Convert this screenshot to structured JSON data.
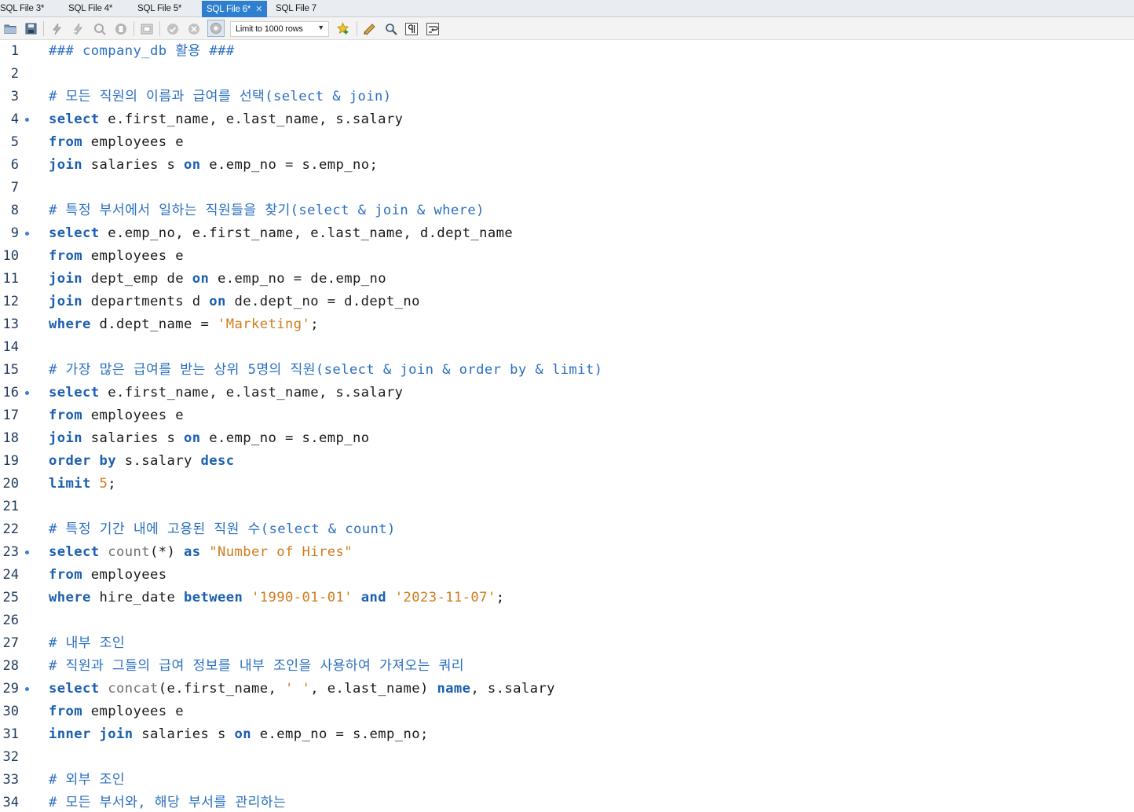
{
  "tabs": [
    {
      "label": "SQL File 3*"
    },
    {
      "label": "SQL File 4*"
    },
    {
      "label": "SQL File 5*"
    },
    {
      "label": "SQL File 6*",
      "active": true
    },
    {
      "label": "SQL File 7"
    }
  ],
  "toolbar": {
    "limit_label": "Limit to 1000 rows",
    "icons": [
      "open-folder-icon",
      "save-icon",
      "execute-icon",
      "execute-current-icon",
      "explain-icon",
      "stop-icon",
      "toggle-output-icon",
      "commit-icon",
      "rollback-icon",
      "autocommit-icon",
      "limit-dropdown",
      "add-snippet-icon",
      "beautify-icon",
      "find-icon",
      "invisible-chars-icon",
      "word-wrap-icon"
    ]
  },
  "editor": {
    "lines": [
      {
        "n": "1",
        "code": "### company_db 활용 ###"
      },
      {
        "n": "2",
        "code": ""
      },
      {
        "n": "3",
        "code": "# 모든 직원의 이름과 급여를 선택(select & join)"
      },
      {
        "n": "4",
        "code": "select e.first_name, e.last_name, s.salary"
      },
      {
        "n": "5",
        "code": "from employees e"
      },
      {
        "n": "6",
        "code": "join salaries s on e.emp_no = s.emp_no;"
      },
      {
        "n": "7",
        "code": ""
      },
      {
        "n": "8",
        "code": "# 특정 부서에서 일하는 직원들을 찾기(select & join & where)"
      },
      {
        "n": "9",
        "code": "select e.emp_no, e.first_name, e.last_name, d.dept_name"
      },
      {
        "n": "10",
        "code": "from employees e"
      },
      {
        "n": "11",
        "code": "join dept_emp de on e.emp_no = de.emp_no"
      },
      {
        "n": "12",
        "code": "join departments d on de.dept_no = d.dept_no"
      },
      {
        "n": "13",
        "code": "where d.dept_name = 'Marketing';"
      },
      {
        "n": "14",
        "code": ""
      },
      {
        "n": "15",
        "code": "# 가장 많은 급여를 받는 상위 5명의 직원(select & join & order by & limit)"
      },
      {
        "n": "16",
        "code": "select e.first_name, e.last_name, s.salary"
      },
      {
        "n": "17",
        "code": "from employees e"
      },
      {
        "n": "18",
        "code": "join salaries s on e.emp_no = s.emp_no"
      },
      {
        "n": "19",
        "code": "order by s.salary desc"
      },
      {
        "n": "20",
        "code": "limit 5;"
      },
      {
        "n": "21",
        "code": ""
      },
      {
        "n": "22",
        "code": "# 특정 기간 내에 고용된 직원 수(select & count)"
      },
      {
        "n": "23",
        "code": "select count(*) as \"Number of Hires\""
      },
      {
        "n": "24",
        "code": "from employees"
      },
      {
        "n": "25",
        "code": "where hire_date between '1990-01-01' and '2023-11-07';"
      },
      {
        "n": "26",
        "code": ""
      },
      {
        "n": "27",
        "code": "# 내부 조인"
      },
      {
        "n": "28",
        "code": "# 직원과 그들의 급여 정보를 내부 조인을 사용하여 가져오는 쿼리"
      },
      {
        "n": "29",
        "code": "select concat(e.first_name, ' ', e.last_name) name, s.salary"
      },
      {
        "n": "30",
        "code": "from employees e"
      },
      {
        "n": "31",
        "code": "inner join salaries s on e.emp_no = s.emp_no;"
      },
      {
        "n": "32",
        "code": ""
      },
      {
        "n": "33",
        "code": "# 외부 조인"
      },
      {
        "n": "34",
        "code": "# 모든 부서와, 해당 부서를 관리하는"
      }
    ]
  },
  "colors": {
    "keyword": "#1b5fb0",
    "string": "#d07d1b",
    "comment": "#2a6fc0",
    "active_tab": "#2e7fd0",
    "statement_dot": "#3a7fd0"
  }
}
